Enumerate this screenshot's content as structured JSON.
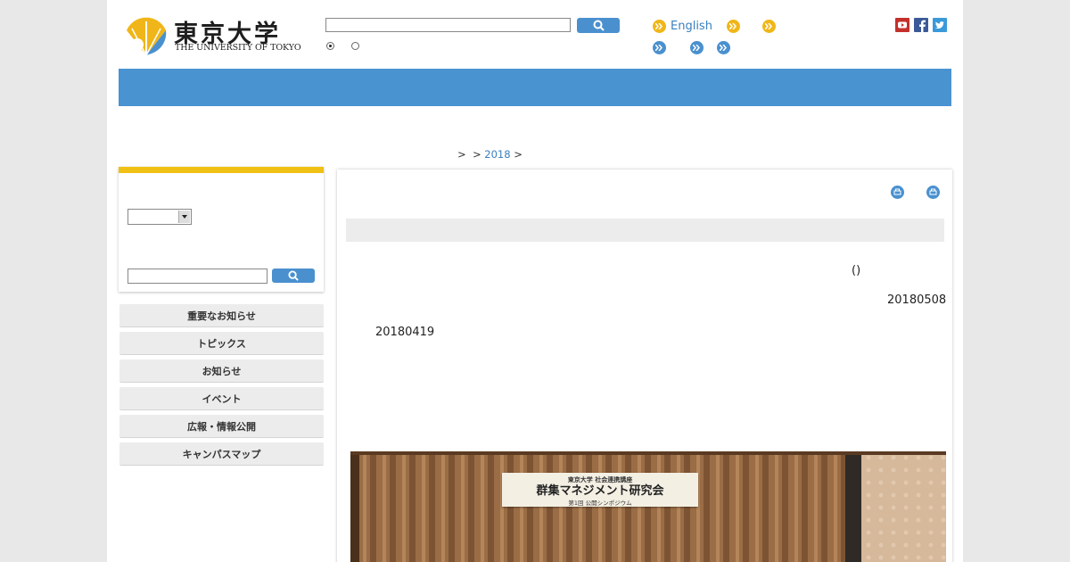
{
  "header": {
    "logo_ja": "東京大学",
    "logo_en": "THE UNIVERSITY OF TOKYO",
    "search_value": "",
    "search_icon": "search-icon",
    "radio_selected": "first",
    "nav": {
      "english_label": "English"
    },
    "social": [
      "youtube-icon",
      "facebook-icon",
      "twitter-icon"
    ]
  },
  "breadcrumb": {
    "sep1": ">",
    "sep2": ">",
    "year_link": "2018",
    "sep3": ">"
  },
  "sidebar": {
    "select_value": "",
    "search_value": "",
    "menu": [
      {
        "label": "重要なお知らせ"
      },
      {
        "label": "トピックス"
      },
      {
        "label": "お知らせ"
      },
      {
        "label": "イベント"
      },
      {
        "label": "広報・情報公開"
      },
      {
        "label": "キャンパスマップ"
      }
    ]
  },
  "article": {
    "paren_text": "()",
    "date_right": "20180508",
    "date_left": "20180419",
    "photo": {
      "sign_line1": "東京大学 社会連携講座",
      "sign_line2": "群集マネジメント研究会",
      "sign_line3": "第1回 公開シンポジウム"
    }
  },
  "colors": {
    "accent_blue": "#4a93d1",
    "accent_yellow": "#f0c015"
  }
}
